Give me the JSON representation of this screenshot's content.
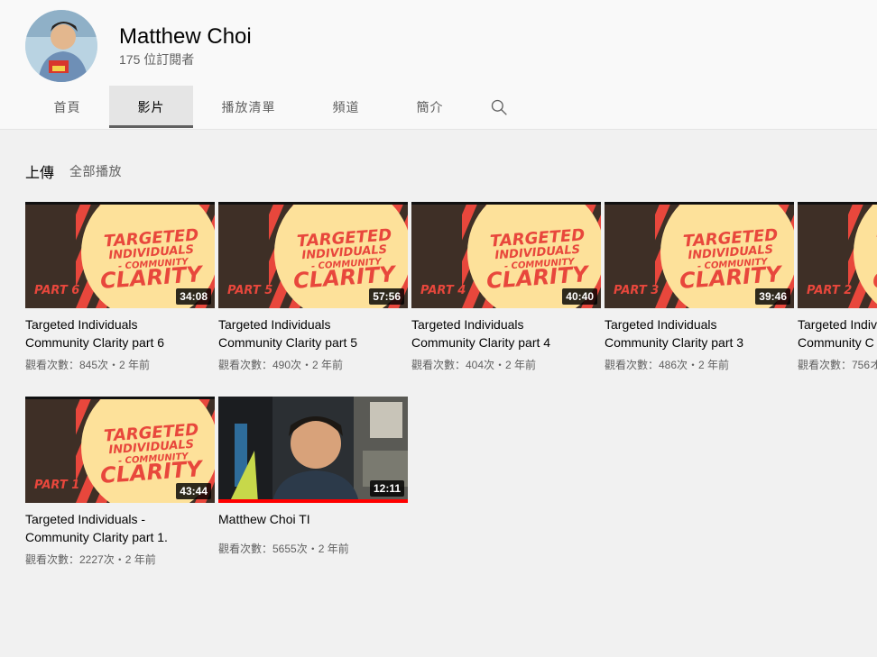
{
  "channel": {
    "name": "Matthew Choi",
    "subscribers": "175 位訂閱者"
  },
  "tabs": [
    {
      "label": "首頁",
      "active": false
    },
    {
      "label": "影片",
      "active": true
    },
    {
      "label": "播放清單",
      "active": false
    },
    {
      "label": "頻道",
      "active": false
    },
    {
      "label": "簡介",
      "active": false
    }
  ],
  "search_icon": "search-icon",
  "section": {
    "title": "上傳",
    "play_all": "全部播放"
  },
  "thumb_art": {
    "line1": "TARGETED",
    "line2": "INDIVIDUALS",
    "line3": "- COMMUNITY",
    "line4": "CLARITY"
  },
  "videos": [
    {
      "title_line1": "Targeted Individuals",
      "title_line2": "Community Clarity part 6",
      "views": "觀看次數：845次・2 年前",
      "duration": "34:08",
      "part": "PART 6"
    },
    {
      "title_line1": "Targeted Individuals",
      "title_line2": "Community Clarity part 5",
      "views": "觀看次數：490次・2 年前",
      "duration": "57:56",
      "part": "PART 5"
    },
    {
      "title_line1": "Targeted Individuals",
      "title_line2": "Community Clarity part 4",
      "views": "觀看次數：404次・2 年前",
      "duration": "40:40",
      "part": "PART 4"
    },
    {
      "title_line1": "Targeted Individuals",
      "title_line2": "Community Clarity part 3",
      "views": "觀看次數：486次・2 年前",
      "duration": "39:46",
      "part": "PART 3"
    },
    {
      "title_line1": "Targeted Indiv",
      "title_line2": "Community C",
      "views": "觀看次數：756オ",
      "duration": "",
      "part": "PART 2"
    },
    {
      "title_line1": "Targeted Individuals -",
      "title_line2": "Community Clarity part 1.",
      "views": "觀看次數：2227次・2 年前",
      "duration": "43:44",
      "part": "PART 1"
    },
    {
      "title_line1": "Matthew Choi TI",
      "title_line2": "",
      "views": "觀看次數：5655次・2 年前",
      "duration": "12:11",
      "part": ""
    }
  ],
  "colors": {
    "stripe": "#e8473c",
    "circle": "#fde19a",
    "dark": "#3e2f26",
    "progress": "#ff0000"
  }
}
